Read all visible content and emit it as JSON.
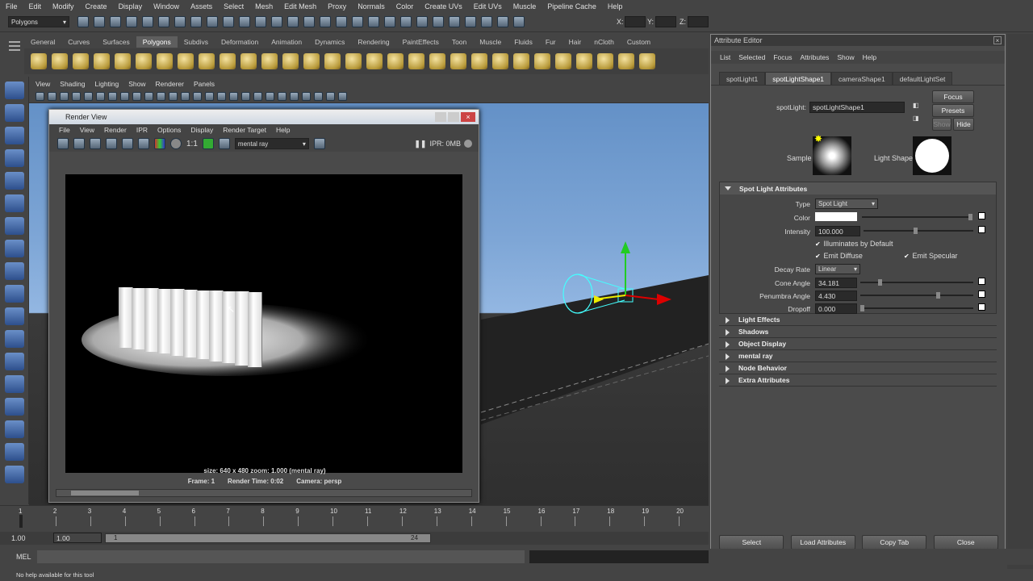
{
  "menubar": [
    "File",
    "Edit",
    "Modify",
    "Create",
    "Display",
    "Window",
    "Assets",
    "Select",
    "Mesh",
    "Edit Mesh",
    "Proxy",
    "Normals",
    "Color",
    "Create UVs",
    "Edit UVs",
    "Muscle",
    "Pipeline Cache",
    "Help"
  ],
  "toolbar": {
    "mode_select": "Polygons",
    "x_label": "X:",
    "y_label": "Y:",
    "z_label": "Z:"
  },
  "shelf_tabs": [
    "General",
    "Curves",
    "Surfaces",
    "Polygons",
    "Subdivs",
    "Deformation",
    "Animation",
    "Dynamics",
    "Rendering",
    "PaintEffects",
    "Toon",
    "Muscle",
    "Fluids",
    "Fur",
    "Hair",
    "nCloth",
    "Custom"
  ],
  "shelf_active": "Polygons",
  "viewport_menu": [
    "View",
    "Shading",
    "Lighting",
    "Show",
    "Renderer",
    "Panels"
  ],
  "render_view": {
    "title": "Render View",
    "menu": [
      "File",
      "View",
      "Render",
      "IPR",
      "Options",
      "Display",
      "Render Target",
      "Help"
    ],
    "ratio_label": "1:1",
    "renderer": "mental ray",
    "ipr_status": "IPR: 0MB",
    "info_line1": "size: 640 x 480  zoom: 1.000        (mental ray)",
    "info_line2_frame": "Frame: 1",
    "info_line2_time": "Render Time: 0:02",
    "info_line2_camera": "Camera: persp"
  },
  "attribute_editor": {
    "title": "Attribute Editor",
    "menu": [
      "List",
      "Selected",
      "Focus",
      "Attributes",
      "Show",
      "Help"
    ],
    "tabs": [
      "spotLight1",
      "spotLightShape1",
      "cameraShape1",
      "defaultLightSet"
    ],
    "active_tab": "spotLightShape1",
    "node_type_label": "spotLight:",
    "node_name": "spotLightShape1",
    "focus_button": "Focus",
    "presets_button": "Presets",
    "show_button": "Show",
    "hide_button": "Hide",
    "sample_label": "Sample",
    "light_shape_label": "Light Shape",
    "section_spot": "Spot Light Attributes",
    "type_label": "Type",
    "type_value": "Spot Light",
    "color_label": "Color",
    "color_value": "#ffffff",
    "intensity_label": "Intensity",
    "intensity_value": "100.000",
    "illuminates_label": "Illuminates by Default",
    "emit_diffuse_label": "Emit Diffuse",
    "emit_specular_label": "Emit Specular",
    "decay_label": "Decay Rate",
    "decay_value": "Linear",
    "cone_label": "Cone Angle",
    "cone_value": "34.181",
    "penumbra_label": "Penumbra Angle",
    "penumbra_value": "4.430",
    "dropoff_label": "Dropoff",
    "dropoff_value": "0.000",
    "collapsed_sections": [
      "Light Effects",
      "Shadows",
      "Object Display",
      "mental ray",
      "Node Behavior",
      "Extra Attributes"
    ],
    "bottom_buttons": [
      "Select",
      "Load Attributes",
      "Copy Tab",
      "Close"
    ]
  },
  "timeline": {
    "ticks": [
      "1",
      "2",
      "3",
      "4",
      "5",
      "6",
      "7",
      "8",
      "9",
      "10",
      "11",
      "12",
      "13",
      "14",
      "15",
      "16",
      "17",
      "18",
      "19",
      "20"
    ],
    "start": "1.00",
    "start2": "1.00",
    "range_start": "1",
    "range_end": "24"
  },
  "mel_label": "MEL",
  "help_text": "No help available for this tool"
}
